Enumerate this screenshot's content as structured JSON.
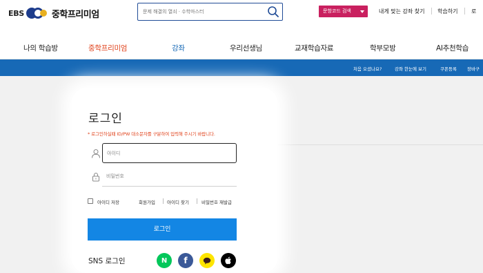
{
  "header": {
    "logo_ebs": "EBS",
    "logo_brand": "중학프리미엄",
    "search_placeholder": "문제 해결의 열쇠 · 수학마스터",
    "code_search_label": "문항코드 검색",
    "links": [
      "내게 맞는 강좌 찾기",
      "학습하기",
      "로"
    ]
  },
  "gnb": {
    "items": [
      "나의 학습방",
      "중학프리미엄",
      "강좌",
      "우리선생님",
      "교재학습자료",
      "학부모방",
      "AI추천학습"
    ]
  },
  "subbar": {
    "links": [
      "처음 오셨나요?",
      "강좌 한눈에 보기",
      "쿠폰등록",
      "장바구"
    ]
  },
  "login": {
    "title": "로그인",
    "notice": "* 로그인하실때 ID/PW 대소문자를 구분하여 입력해 주시기 바랍니다.",
    "id_placeholder": "아이디",
    "pw_placeholder": "비밀번호",
    "remember_label": "아이디 저장",
    "signup": "회원가입",
    "find_id": "아이디 찾기",
    "reset_pw": "비밀번호 재발급",
    "submit": "로그인",
    "sns_label": "SNS 로그인",
    "naver_letter": "N",
    "facebook_letter": "f"
  },
  "colors": {
    "accent_pink": "#c9205f",
    "gnb_active": "#e0421b",
    "gnb_blue": "#1769b6",
    "login_button": "#1386e4",
    "naver": "#03c75a",
    "facebook": "#3b5998",
    "kakao": "#fee500",
    "apple": "#000000"
  },
  "icons": [
    "search-icon",
    "user-icon",
    "lock-icon",
    "chevron-down-icon",
    "naver-icon",
    "facebook-icon",
    "kakao-icon",
    "apple-icon"
  ]
}
